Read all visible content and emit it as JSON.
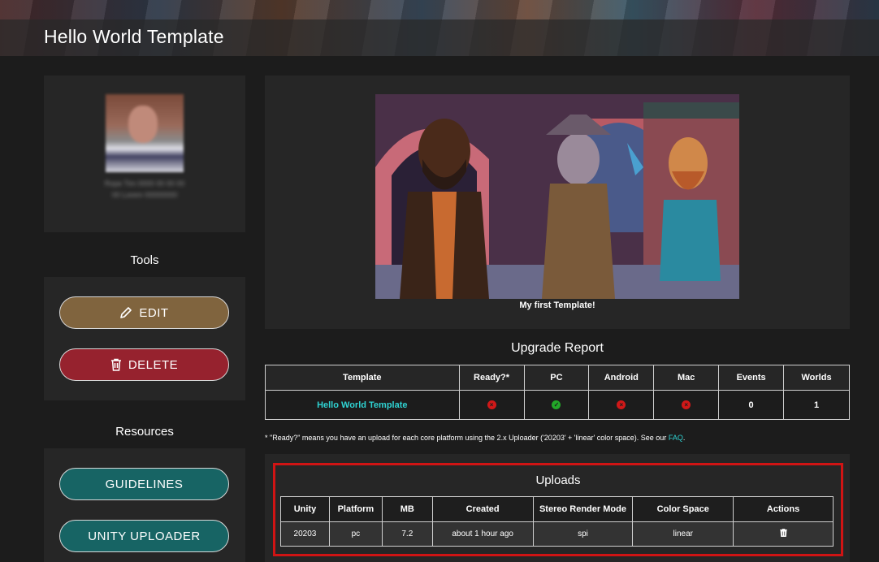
{
  "header": {
    "title": "Hello World Template"
  },
  "profile": {
    "blurred_line_1": "Rope Tim 0000 00 00 00",
    "blurred_line_2": "00 Lorem 00000000"
  },
  "tools": {
    "heading": "Tools",
    "edit_label": "EDIT",
    "delete_label": "DELETE",
    "edit_color": "#80643e",
    "delete_color": "#96222e"
  },
  "resources": {
    "heading": "Resources",
    "guidelines_label": "GUIDELINES",
    "uploader_label": "UNITY UPLOADER",
    "button_color": "#176464"
  },
  "preview": {
    "caption": "My first Template!"
  },
  "report": {
    "title": "Upgrade Report",
    "columns": [
      "Template",
      "Ready?*",
      "PC",
      "Android",
      "Mac",
      "Events",
      "Worlds"
    ],
    "row": {
      "template": "Hello World Template",
      "ready": "no",
      "pc": "yes",
      "android": "no",
      "mac": "no",
      "events": "0",
      "worlds": "1"
    },
    "footnote": "* \"Ready?\" means you have an upload for each core platform using the 2.x Uploader ('20203' + 'linear' color space). See our ",
    "footnote_link": "FAQ",
    "footnote_end": "."
  },
  "uploads": {
    "title": "Uploads",
    "columns": [
      "Unity",
      "Platform",
      "MB",
      "Created",
      "Stereo Render Mode",
      "Color Space",
      "Actions"
    ],
    "rows": [
      {
        "unity": "20203",
        "platform": "pc",
        "mb": "7.2",
        "created": "about 1 hour ago",
        "stereo": "spi",
        "color_space": "linear",
        "action_icon": "trash-icon"
      }
    ]
  },
  "colors": {
    "accent_link": "#2fd3d3",
    "status_red": "#d01818",
    "status_green": "#22a828",
    "highlight_border": "#d01414"
  }
}
